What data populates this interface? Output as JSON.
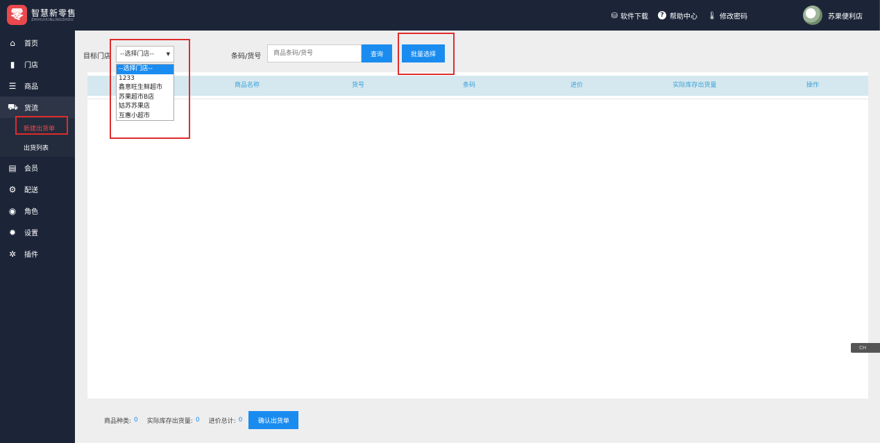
{
  "app": {
    "logo_badge": "零",
    "name_cn": "智慧新零售",
    "name_en": "ZHIHUIXINLINGSHOU"
  },
  "topbar": {
    "download": "软件下载",
    "help": "帮助中心",
    "change_password": "修改密码",
    "username": "苏果便利店"
  },
  "sidebar": {
    "items": [
      {
        "label": "首页",
        "icon": "home-icon"
      },
      {
        "label": "门店",
        "icon": "building-icon"
      },
      {
        "label": "商品",
        "icon": "list-icon"
      },
      {
        "label": "货流",
        "icon": "truck-icon"
      },
      {
        "label": "会员",
        "icon": "id-card-icon"
      },
      {
        "label": "配送",
        "icon": "motorcycle-icon"
      },
      {
        "label": "角色",
        "icon": "user-circle-icon"
      },
      {
        "label": "设置",
        "icon": "gear-icon"
      },
      {
        "label": "插件",
        "icon": "cogs-icon"
      }
    ],
    "sub_items": [
      {
        "label": "新建出货单"
      },
      {
        "label": "出货列表"
      }
    ]
  },
  "filter": {
    "target_store_label": "目标门店",
    "store_select_value": "--选择门店--",
    "barcode_label": "条码/货号",
    "search_placeholder": "商品条码/货号",
    "query_button": "查询",
    "batch_button": "批量选择"
  },
  "dropdown": {
    "options": [
      "--选择门店--",
      "1233",
      "鑫意旺生鲜超市",
      "苏果超市B店",
      "姑苏苏果店",
      "互惠小超市"
    ]
  },
  "table": {
    "headers": [
      "商品名称",
      "货号",
      "条码",
      "进价",
      "实际库存出货量",
      "操作"
    ]
  },
  "footer": {
    "kinds_label": "商品种类:",
    "kinds_value": "0",
    "stock_label": "实际库存出货量:",
    "stock_value": "0",
    "total_label": "进价总计:",
    "total_value": "0",
    "confirm_button": "确认出货单"
  },
  "float_widget": "CH"
}
